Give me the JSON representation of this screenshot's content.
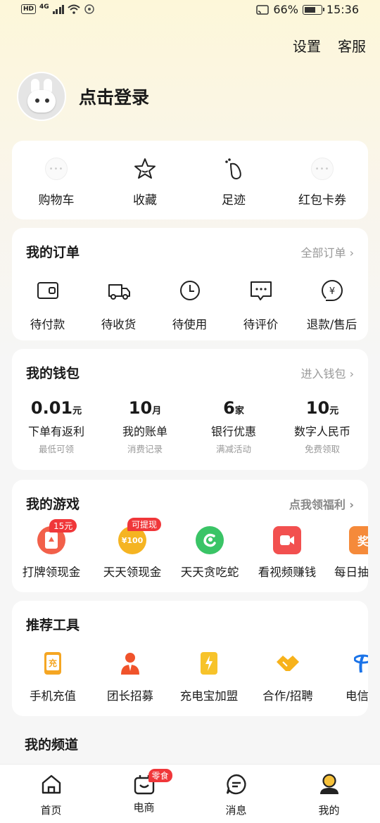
{
  "status_bar": {
    "hd": "HD",
    "net": "4G",
    "battery": "66%",
    "time": "15:36"
  },
  "header": {
    "settings": "设置",
    "service": "客服",
    "login": "点击登录"
  },
  "quick": [
    {
      "label": "购物车",
      "icon": "cart-placeholder-icon"
    },
    {
      "label": "收藏",
      "icon": "star-icon"
    },
    {
      "label": "足迹",
      "icon": "footprint-icon"
    },
    {
      "label": "红包卡券",
      "icon": "coupon-placeholder-icon"
    }
  ],
  "orders": {
    "title": "我的订单",
    "link": "全部订单",
    "items": [
      {
        "label": "待付款",
        "icon": "wallet-icon"
      },
      {
        "label": "待收货",
        "icon": "truck-icon"
      },
      {
        "label": "待使用",
        "icon": "clock-icon"
      },
      {
        "label": "待评价",
        "icon": "comment-icon"
      },
      {
        "label": "退款/售后",
        "icon": "refund-icon"
      }
    ]
  },
  "wallet": {
    "title": "我的钱包",
    "link": "进入钱包",
    "items": [
      {
        "value": "0.01",
        "unit": "元",
        "label": "下单有返利",
        "sub": "最低可领"
      },
      {
        "value": "10",
        "unit": "月",
        "label": "我的账单",
        "sub": "消费记录"
      },
      {
        "value": "6",
        "unit": "家",
        "label": "银行优惠",
        "sub": "满减活动"
      },
      {
        "value": "10",
        "unit": "元",
        "label": "数字人民币",
        "sub": "免费领取"
      }
    ]
  },
  "games": {
    "title": "我的游戏",
    "link": "点我领福利",
    "items": [
      {
        "label": "打牌领现金",
        "badge": "15元",
        "icon": "card-game-icon",
        "color": "#f2604a"
      },
      {
        "label": "天天领现金",
        "badge": "可提现",
        "icon": "coin-icon",
        "coin_text": "¥100",
        "color": "#f5b422"
      },
      {
        "label": "天天贪吃蛇",
        "badge": "",
        "icon": "snake-icon",
        "color": "#3ac466"
      },
      {
        "label": "看视频赚钱",
        "badge": "",
        "icon": "video-icon",
        "color": "#f2504f"
      },
      {
        "label": "每日抽",
        "badge": "",
        "icon": "lottery-icon",
        "glyph": "奖",
        "color": "#f58a3a"
      }
    ]
  },
  "tools": {
    "title": "推荐工具",
    "items": [
      {
        "label": "手机充值",
        "icon": "phone-recharge-icon",
        "glyph": "充"
      },
      {
        "label": "团长招募",
        "icon": "leader-icon"
      },
      {
        "label": "充电宝加盟",
        "icon": "power-bank-icon"
      },
      {
        "label": "合作/招聘",
        "icon": "handshake-icon"
      },
      {
        "label": "电信营",
        "icon": "telecom-icon"
      }
    ]
  },
  "channels": {
    "title": "我的频道"
  },
  "tabbar": [
    {
      "label": "首页",
      "icon": "home-icon"
    },
    {
      "label": "电商",
      "icon": "shop-icon",
      "badge": "零食"
    },
    {
      "label": "消息",
      "icon": "message-icon"
    },
    {
      "label": "我的",
      "icon": "profile-icon"
    }
  ]
}
